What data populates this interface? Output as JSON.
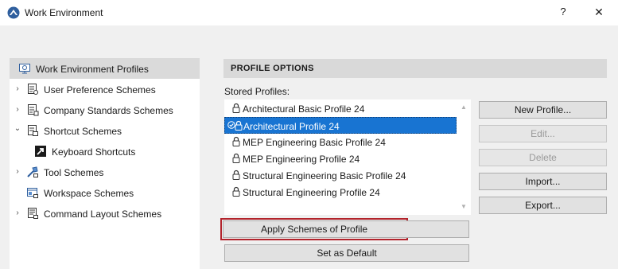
{
  "window": {
    "title": "Work Environment",
    "help_glyph": "?",
    "close_glyph": "✕"
  },
  "sidebar": {
    "items": [
      {
        "label": "Work Environment Profiles",
        "expand": ""
      },
      {
        "label": "User Preference Schemes",
        "expand": "›"
      },
      {
        "label": "Company Standards Schemes",
        "expand": "›"
      },
      {
        "label": "Shortcut Schemes",
        "expand": "⌄"
      },
      {
        "label": "Keyboard Shortcuts",
        "expand": ""
      },
      {
        "label": "Tool Schemes",
        "expand": "›"
      },
      {
        "label": "Workspace Schemes",
        "expand": ""
      },
      {
        "label": "Command Layout Schemes",
        "expand": "›"
      }
    ]
  },
  "panel": {
    "header": "PROFILE OPTIONS",
    "stored_label": "Stored Profiles:",
    "profiles": [
      "Architectural Basic Profile 24",
      "Architectural Profile 24",
      "MEP Engineering Basic Profile 24",
      "MEP Engineering Profile 24",
      "Structural Engineering Basic Profile 24",
      "Structural Engineering Profile 24"
    ],
    "selected_profile": "Architectural Profile 24",
    "buttons": {
      "new": "New Profile...",
      "edit": "Edit...",
      "delete": "Delete",
      "import": "Import...",
      "export": "Export...",
      "apply": "Apply Schemes of Profile",
      "set_default": "Set as Default"
    }
  },
  "colors": {
    "selection": "#1874d2",
    "highlight_outline": "#b2232b",
    "app_icon": "#2f5f9e"
  }
}
